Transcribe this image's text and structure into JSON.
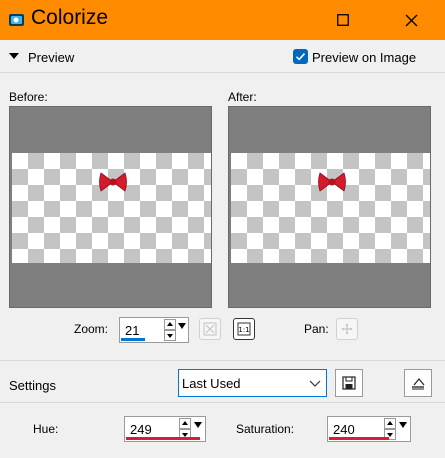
{
  "window": {
    "title": "Colorize",
    "accent": "#ff8c00"
  },
  "preview_section": {
    "label": "Preview",
    "preview_on_image": {
      "label": "Preview on Image",
      "checked": true
    }
  },
  "panels": {
    "before_label": "Before:",
    "after_label": "After:"
  },
  "zoom": {
    "label": "Zoom:",
    "value": "21"
  },
  "pan": {
    "label": "Pan:"
  },
  "settings": {
    "label": "Settings",
    "preset": "Last Used"
  },
  "hue": {
    "label": "Hue:",
    "value": "249"
  },
  "saturation": {
    "label": "Saturation:",
    "value": "240"
  },
  "colors": {
    "checkbox": "#0067c0",
    "bow": "#d41a2c",
    "zoom_bar": "#0078d4",
    "color_bar": "#d21f35"
  }
}
